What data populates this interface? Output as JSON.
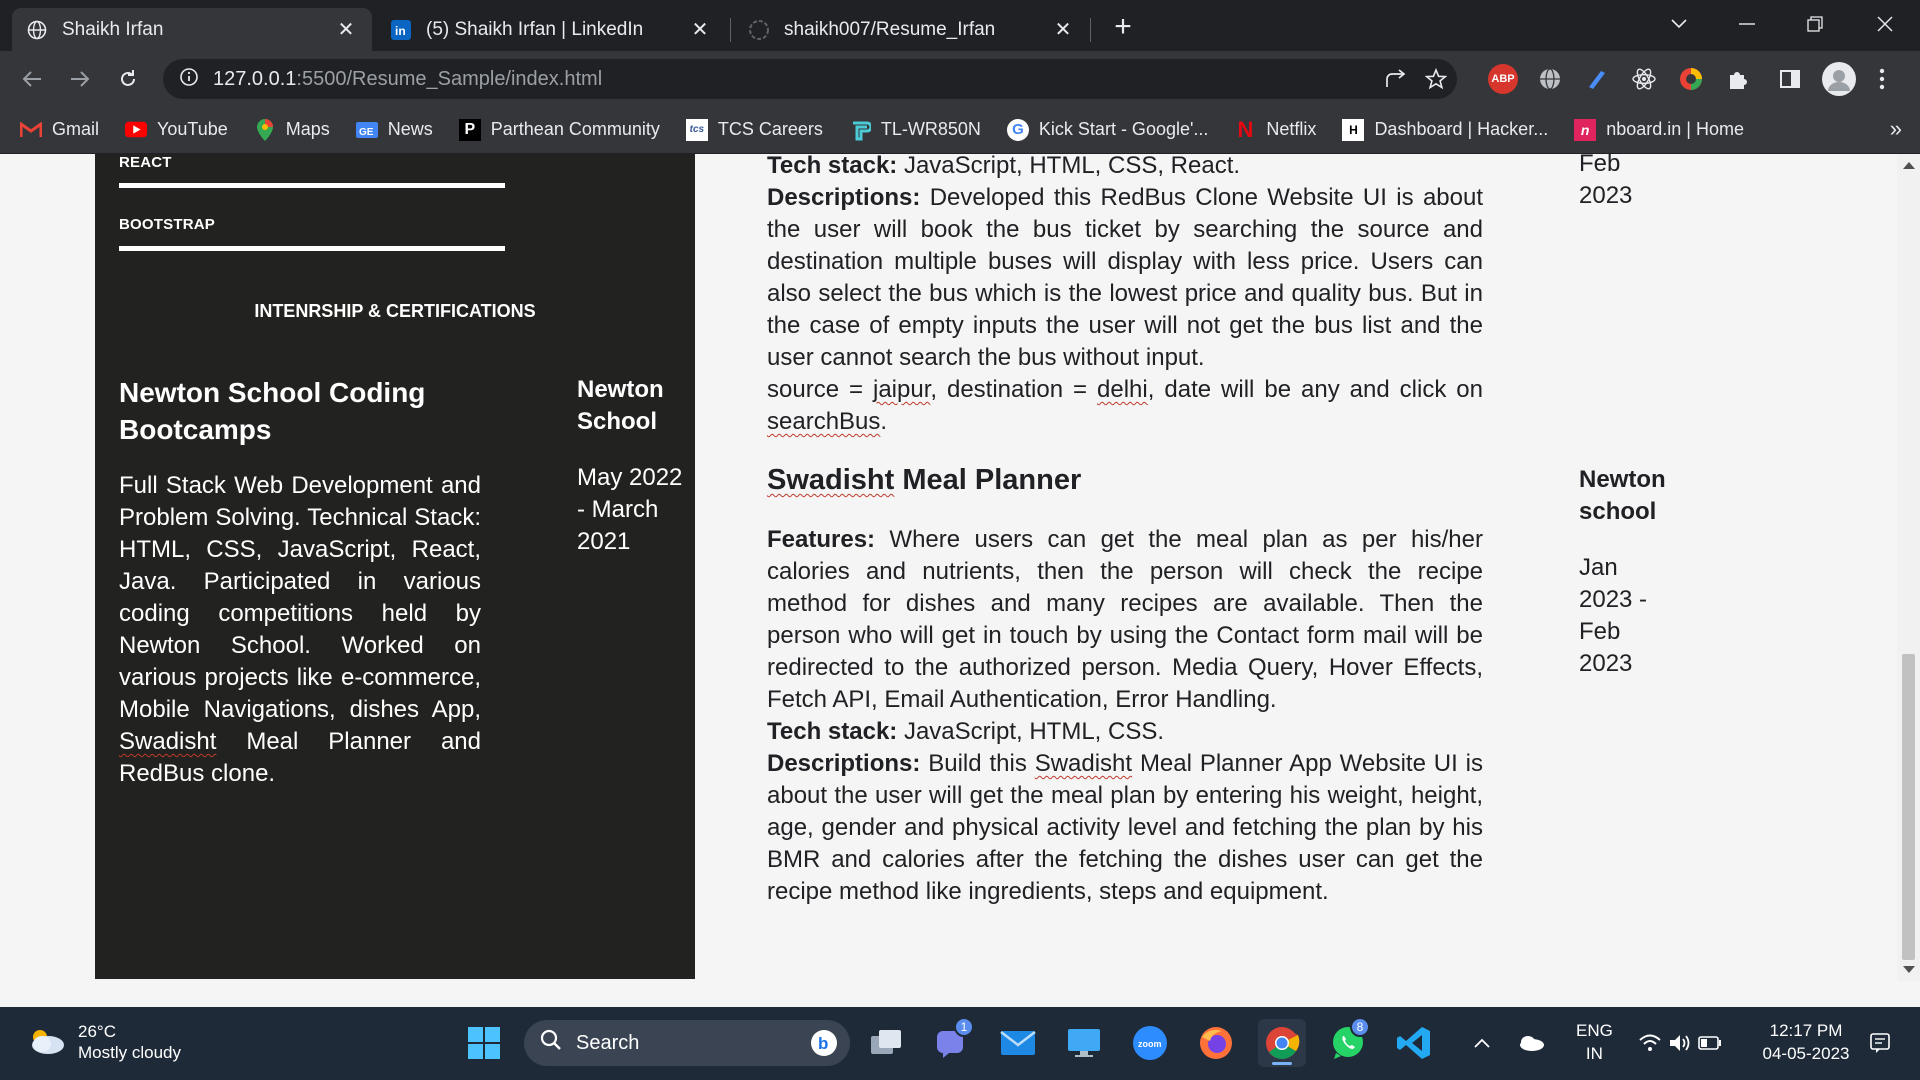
{
  "browser": {
    "tabs": [
      {
        "title": "Shaikh Irfan",
        "close": "✕",
        "icon": "globe-icon"
      },
      {
        "title": "(5) Shaikh Irfan | LinkedIn",
        "close": "✕",
        "icon": "linkedin-icon"
      },
      {
        "title": "shaikh007/Resume_Irfan",
        "close": "✕",
        "icon": "github-icon"
      }
    ],
    "new_tab": "+",
    "url_host": "127.0.0.1",
    "url_path": ":5500/Resume_Sample/index.html",
    "bookmarks": [
      {
        "label": "Gmail",
        "icon": "gmail-icon"
      },
      {
        "label": "YouTube",
        "icon": "youtube-icon"
      },
      {
        "label": "Maps",
        "icon": "maps-icon"
      },
      {
        "label": "News",
        "icon": "news-icon"
      },
      {
        "label": "Parthean Community",
        "icon": "parthean-icon"
      },
      {
        "label": "TCS Careers",
        "icon": "tcs-icon"
      },
      {
        "label": "TL-WR850N",
        "icon": "tplink-icon"
      },
      {
        "label": "Kick Start - Google'...",
        "icon": "google-icon"
      },
      {
        "label": "Netflix",
        "icon": "netflix-icon"
      },
      {
        "label": "Dashboard | Hacker...",
        "icon": "hackerrank-icon"
      },
      {
        "label": "nboard.in | Home",
        "icon": "nboard-icon"
      }
    ],
    "bookmarks_more": "»"
  },
  "resume": {
    "skills": [
      "REACT",
      "BOOTSTRAP"
    ],
    "section_heading": "INTENRSHIP & CERTIFICATIONS",
    "internship": {
      "title": "Newton School Coding Bootcamps",
      "org": "Newton School",
      "date": "May 2022 - March 2021",
      "desc_before": "Full Stack Web Development and Problem Solving. Technical Stack: HTML, CSS, JavaScript, React, Java. Participated in various coding competitions held by Newton School. Worked on various projects like e-commerce, Mobile Navigations, dishes App, ",
      "desc_flagged": "Swadisht",
      "desc_after": " Meal Planner and RedBus clone."
    },
    "redbus": {
      "tech_label": "Tech stack:",
      "tech": " JavaScript, HTML, CSS, React.",
      "desc_label": "Descriptions:",
      "desc": " Developed this RedBus Clone Website UI is about the user will book the bus ticket by searching the source and destination multiple buses will display with less price. Users can also select the bus which is the lowest price and quality bus. But in the case of empty inputs the user will not get the bus list and the user cannot search the bus without input.",
      "example_1": "source = ",
      "example_jaipur": "jaipur",
      "example_2": ", destination = ",
      "example_delhi": "delhi",
      "example_3": ", date will be any and click on ",
      "example_search": "searchBus",
      "example_4": ".",
      "date_tail": "Feb 2023"
    },
    "meal": {
      "title_flagged": "Swadisht",
      "title_rest": " Meal Planner",
      "org": "Newton school",
      "date": "Jan 2023 - Feb 2023",
      "features_label": "Features:",
      "features": " Where users can get the meal plan as per his/her calories and nutrients, then the person will check the recipe method for dishes and many recipes are available. Then the person who will get in touch by using the Contact form mail will be redirected to the authorized person. Media Query, Hover Effects, Fetch API, Email Authentication, Error Handling.",
      "tech_label": "Tech stack:",
      "tech": " JavaScript, HTML, CSS.",
      "desc_label": "Descriptions:",
      "desc_1": " Build this ",
      "desc_flagged": "Swadisht",
      "desc_2": " Meal Planner App Website UI is about the user will get the meal plan by entering his weight, height, age, gender and physical activity level and fetching the plan by his BMR and calories after the fetching the dishes user can get the recipe method like ingredients, steps and equipment."
    }
  },
  "taskbar": {
    "temperature": "26°C",
    "condition": "Mostly cloudy",
    "search_label": "Search",
    "teams_badge": "1",
    "whatsapp_badge": "8",
    "lang_1": "ENG",
    "lang_2": "IN",
    "time": "12:17 PM",
    "date": "04-05-2023"
  },
  "colors": {
    "sidebar_bg": "#222220",
    "chrome_dark": "#202124",
    "chrome_toolbar": "#35363a",
    "taskbar_bg": "#1f2a38",
    "abp_red": "#d6362c"
  }
}
